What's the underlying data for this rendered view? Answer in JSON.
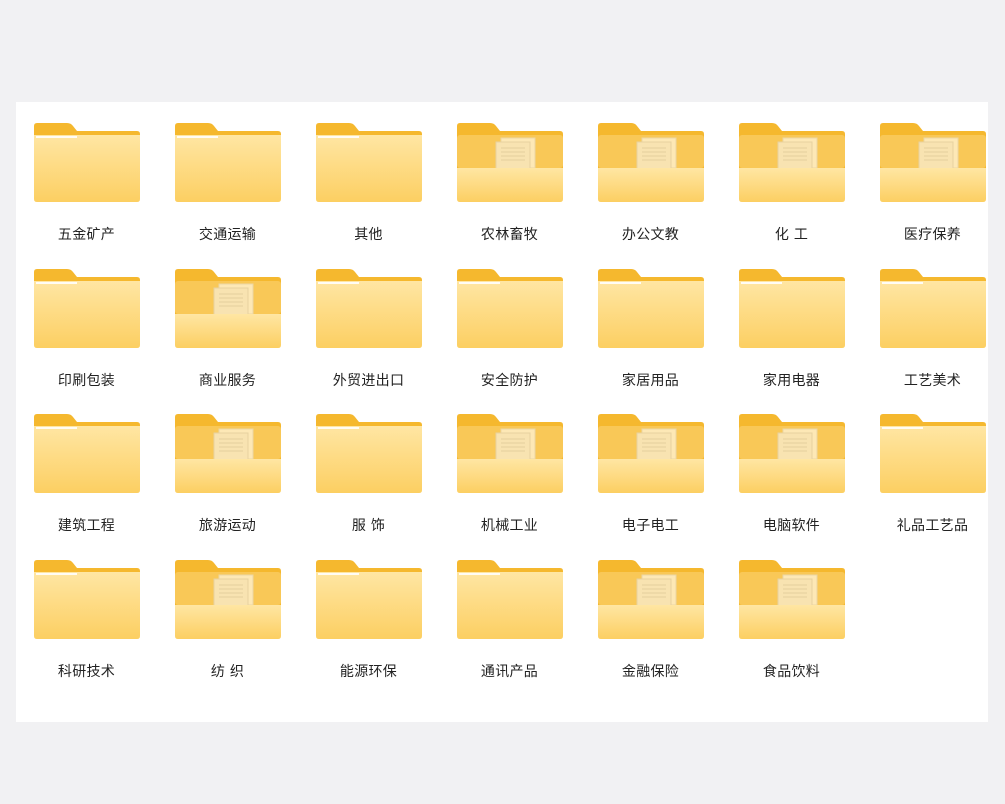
{
  "folders": [
    {
      "name": "五金矿产",
      "has_files": false
    },
    {
      "name": "交通运输",
      "has_files": false
    },
    {
      "name": "其他",
      "has_files": false
    },
    {
      "name": "农林畜牧",
      "has_files": true
    },
    {
      "name": "办公文教",
      "has_files": true
    },
    {
      "name": "化 工",
      "has_files": true
    },
    {
      "name": "医疗保养",
      "has_files": true
    },
    {
      "name": "印刷包装",
      "has_files": false
    },
    {
      "name": "商业服务",
      "has_files": true
    },
    {
      "name": "外贸进出口",
      "has_files": false
    },
    {
      "name": "安全防护",
      "has_files": false
    },
    {
      "name": "家居用品",
      "has_files": false
    },
    {
      "name": "家用电器",
      "has_files": false
    },
    {
      "name": "工艺美术",
      "has_files": false
    },
    {
      "name": "建筑工程",
      "has_files": false
    },
    {
      "name": "旅游运动",
      "has_files": true
    },
    {
      "name": "服 饰",
      "has_files": false
    },
    {
      "name": "机械工业",
      "has_files": true
    },
    {
      "name": "电子电工",
      "has_files": true
    },
    {
      "name": "电脑软件",
      "has_files": true
    },
    {
      "name": "礼品工艺品",
      "has_files": false
    },
    {
      "name": "科研技术",
      "has_files": false
    },
    {
      "name": "纺 织",
      "has_files": true
    },
    {
      "name": "能源环保",
      "has_files": false
    },
    {
      "name": "通讯产品",
      "has_files": false
    },
    {
      "name": "金融保险",
      "has_files": true
    },
    {
      "name": "食品饮料",
      "has_files": true
    }
  ],
  "colors": {
    "folder_back": "#f5b82e",
    "folder_front_top": "#ffe6a3",
    "folder_front_bottom": "#fccf62",
    "paper": "#f4f4f4",
    "background": "#f1f1f3",
    "panel": "#ffffff"
  },
  "icons": {
    "empty_folder": "folder-icon",
    "filled_folder": "folder-with-files-icon"
  }
}
